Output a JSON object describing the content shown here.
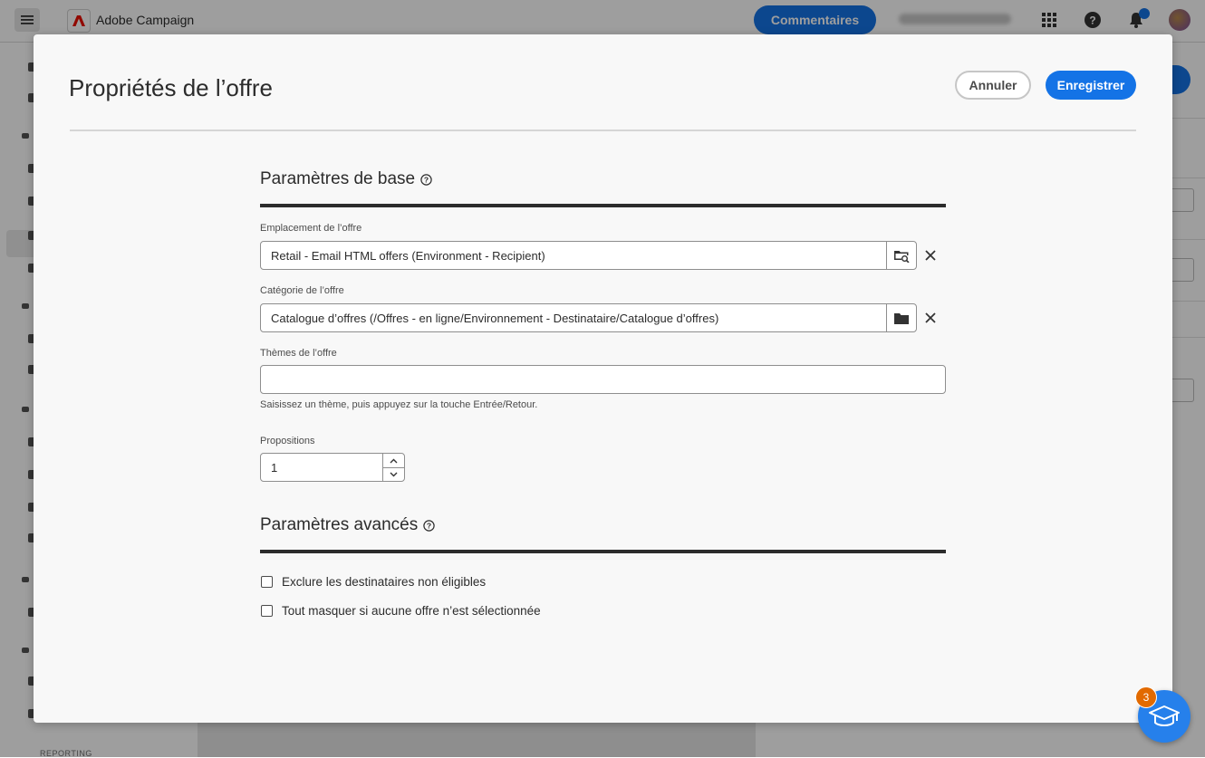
{
  "app": {
    "name": "Adobe Campaign",
    "feedback_label": "Commentaires",
    "sidebar_section": "REPORTING"
  },
  "dialog": {
    "title": "Propriétés de l’offre",
    "cancel_label": "Annuler",
    "save_label": "Enregistrer"
  },
  "basic": {
    "title": "Paramètres de base",
    "placement": {
      "label": "Emplacement de l’offre",
      "value": "Retail - Email HTML offers (Environment - Recipient)"
    },
    "category": {
      "label": "Catégorie de l’offre",
      "value": "Catalogue d’offres (/Offres - en ligne/Environnement - Destinataire/Catalogue d’offres)"
    },
    "themes": {
      "label": "Thèmes de l’offre",
      "value": "",
      "help": "Saisissez un thème, puis appuyez sur la touche Entrée/Retour."
    },
    "propositions": {
      "label": "Propositions",
      "value": "1"
    }
  },
  "advanced": {
    "title": "Paramètres avancés",
    "options": [
      {
        "label": "Exclure les destinataires non éligibles",
        "checked": false
      },
      {
        "label": "Tout masquer si aucune offre n’est sélectionnée",
        "checked": false
      }
    ]
  },
  "learn": {
    "badge_count": "3"
  },
  "colors": {
    "accent": "#1473e6",
    "badge": "#e26a00"
  }
}
